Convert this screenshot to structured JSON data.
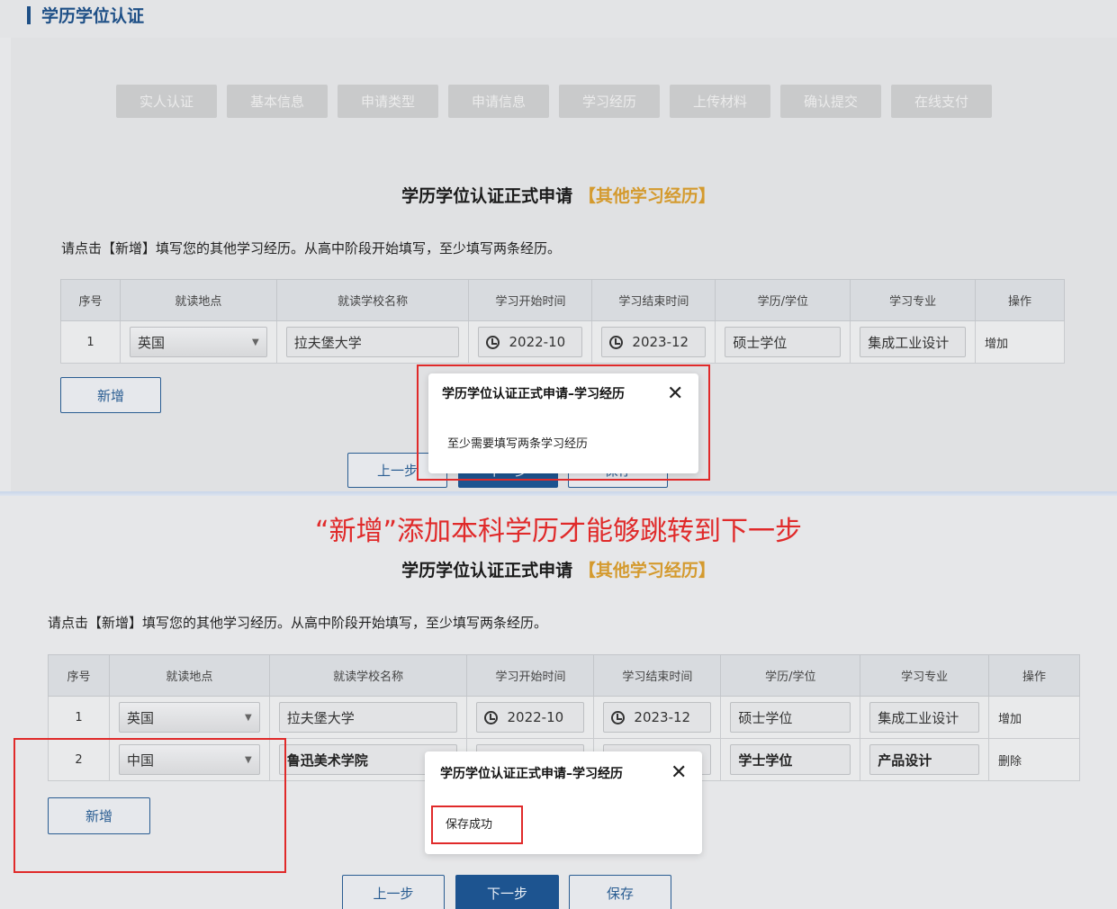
{
  "page_title": "学历学位认证",
  "steps": [
    "实人认证",
    "基本信息",
    "申请类型",
    "申请信息",
    "学习经历",
    "上传材料",
    "确认提交",
    "在线支付"
  ],
  "form_title": "学历学位认证正式申请",
  "form_title_highlight": "【其他学习经历】",
  "instruction": "请点击【新增】填写您的其他学习经历。从高中阶段开始填写，至少填写两条经历。",
  "table": {
    "headers": [
      "序号",
      "就读地点",
      "就读学校名称",
      "学习开始时间",
      "学习结束时间",
      "学历/学位",
      "学习专业",
      "操作"
    ],
    "rows": [
      {
        "no": "1",
        "location": "英国",
        "school": "拉夫堡大学",
        "start": "2022-10",
        "end": "2023-12",
        "degree": "硕士学位",
        "major": "集成工业设计",
        "action": "增加"
      },
      {
        "no": "2",
        "location": "中国",
        "school": "鲁迅美术学院",
        "degree": "学士学位",
        "major": "产品设计",
        "action": "删除"
      }
    ]
  },
  "buttons": {
    "add": "新增",
    "prev": "上一步",
    "next": "下一步",
    "save": "保存"
  },
  "modal_top": {
    "title": "学历学位认证正式申请–学习经历",
    "close": "✕",
    "message": "至少需要填写两条学习经历"
  },
  "modal_bottom": {
    "title": "学历学位认证正式申请–学习经历",
    "close": "✕",
    "message": "保存成功"
  },
  "annotation": "“新增”添加本科学历才能够跳转到下一步",
  "colors": {
    "accent": "#1e4f86",
    "highlight": "#d49a2e",
    "annotation_red": "#e02a2a",
    "primary_button": "#1d5490"
  }
}
